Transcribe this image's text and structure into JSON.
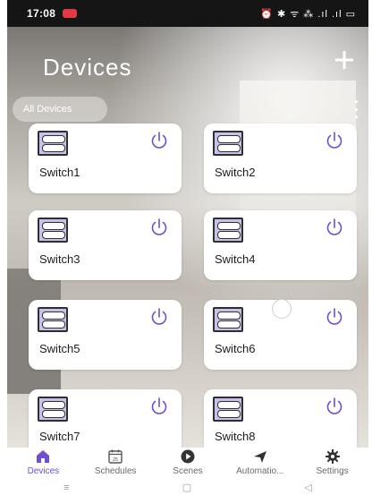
{
  "status_bar": {
    "time": "17:08",
    "icons": "⏰ ✱ ᯤ ⁂ .ıl .ıl ▭"
  },
  "header": {
    "title": "Devices",
    "add_icon": "plus-icon"
  },
  "filter": {
    "label": "All Devices",
    "more_icon": "more-vertical-icon"
  },
  "accent_color": "#6d4fd6",
  "devices": [
    {
      "name": "Switch1"
    },
    {
      "name": "Switch2"
    },
    {
      "name": "Switch3"
    },
    {
      "name": "Switch4"
    },
    {
      "name": "Switch5"
    },
    {
      "name": "Switch6"
    },
    {
      "name": "Switch7"
    },
    {
      "name": "Switch8"
    }
  ],
  "nav": {
    "active": "Devices",
    "items": [
      {
        "label": "Devices",
        "icon": "home-icon"
      },
      {
        "label": "Schedules",
        "icon": "calendar-icon",
        "icon_text": "25"
      },
      {
        "label": "Scenes",
        "icon": "play-icon"
      },
      {
        "label": "Automatio...",
        "icon": "send-icon"
      },
      {
        "label": "Settings",
        "icon": "gear-icon"
      }
    ]
  },
  "system_nav": {
    "menu": "≡",
    "home": "▢",
    "back": "◁"
  }
}
